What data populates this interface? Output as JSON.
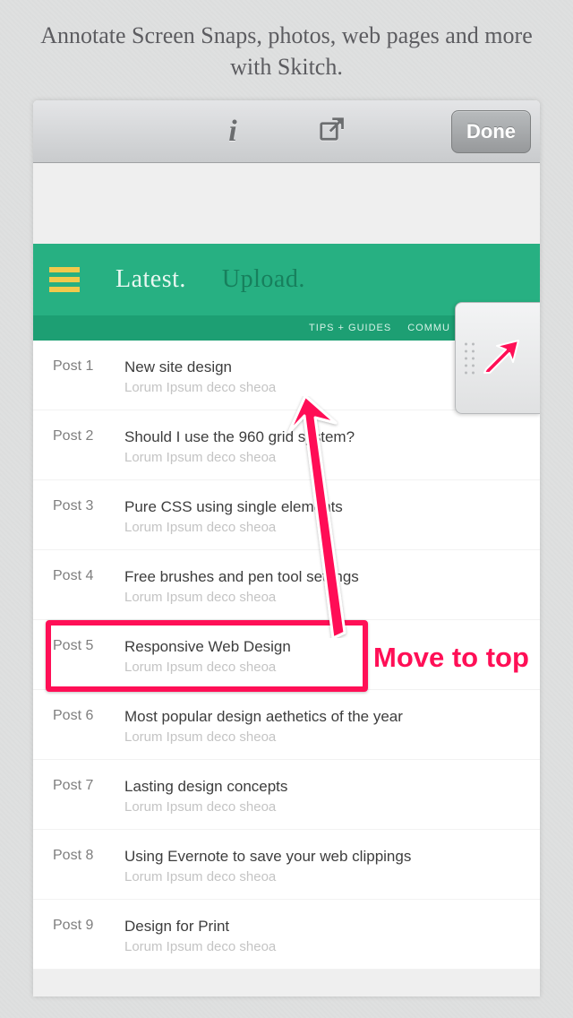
{
  "promo": "Annotate Screen Snaps, photos, web pages and more with Skitch.",
  "toolbar": {
    "done_label": "Done",
    "info_glyph": "i"
  },
  "page_nav": {
    "latest": "Latest.",
    "upload": "Upload.",
    "subnav": {
      "a": "TIPS + GUIDES",
      "b": "COMMU"
    }
  },
  "posts": [
    {
      "label": "Post 1",
      "title": "New site design",
      "sub": "Lorum Ipsum deco sheoa"
    },
    {
      "label": "Post 2",
      "title": "Should I use the 960 grid system?",
      "sub": "Lorum Ipsum deco sheoa"
    },
    {
      "label": "Post 3",
      "title": "Pure CSS using single elements",
      "sub": "Lorum Ipsum deco sheoa"
    },
    {
      "label": "Post 4",
      "title": "Free brushes and pen tool settings",
      "sub": "Lorum Ipsum deco sheoa"
    },
    {
      "label": "Post 5",
      "title": "Responsive Web Design",
      "sub": "Lorum Ipsum deco sheoa"
    },
    {
      "label": "Post 6",
      "title": "Most popular design aethetics of the year",
      "sub": "Lorum Ipsum deco sheoa"
    },
    {
      "label": "Post 7",
      "title": "Lasting design concepts",
      "sub": "Lorum Ipsum deco sheoa"
    },
    {
      "label": "Post 8",
      "title": "Using Evernote to save your web clippings",
      "sub": "Lorum Ipsum deco sheoa"
    },
    {
      "label": "Post 9",
      "title": "Design for Print",
      "sub": "Lorum Ipsum deco sheoa"
    }
  ],
  "annotation": {
    "label": "Move to top",
    "color": "#ff0f56"
  }
}
